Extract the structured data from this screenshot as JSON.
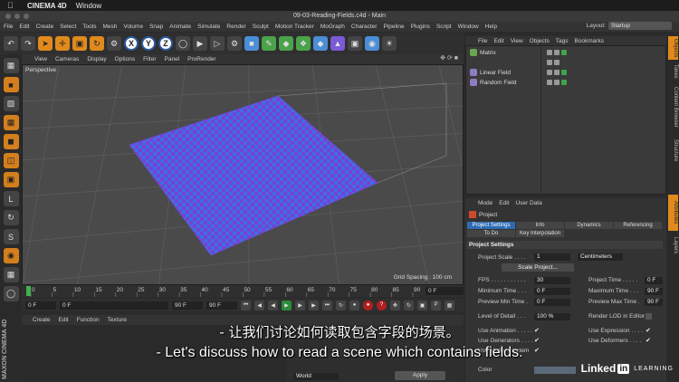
{
  "mac_menubar": {
    "app": "CINEMA 4D",
    "window": "Window"
  },
  "window_title": "09-03-Reading-Fields.c4d - Main",
  "menu": [
    "File",
    "Edit",
    "Create",
    "Select",
    "Tools",
    "Mesh",
    "Volume",
    "Snap",
    "Animate",
    "Simulate",
    "Render",
    "Sculpt",
    "Motion Tracker",
    "MoGraph",
    "Character",
    "Pipeline",
    "Plugins",
    "Script",
    "Window",
    "Help"
  ],
  "layout": {
    "label": "Layout:",
    "value": "Startup"
  },
  "toolbar": {
    "axis_x": "X",
    "axis_y": "Y",
    "axis_z": "Z"
  },
  "viewport": {
    "menu": [
      "View",
      "Cameras",
      "Display",
      "Options",
      "Filter",
      "Panel",
      "ProRender"
    ],
    "label": "Perspective",
    "grid_spacing": "Grid Spacing : 100 cm"
  },
  "timeline": {
    "ticks": [
      "0",
      "5",
      "10",
      "15",
      "20",
      "25",
      "30",
      "35",
      "40",
      "45",
      "50",
      "55",
      "60",
      "65",
      "70",
      "75",
      "80",
      "85",
      "90"
    ],
    "current_frame": "0 F"
  },
  "playbar": {
    "start": "0 F",
    "min": "0 F",
    "max": "90 F",
    "end": "90 F"
  },
  "material_menu": [
    "Create",
    "Edit",
    "Function",
    "Texture"
  ],
  "coords": {
    "apply": "Apply",
    "world": "World"
  },
  "maxon_logo": "MAXON CINEMA 4D",
  "object_manager": {
    "menu": [
      "File",
      "Edit",
      "View",
      "Objects",
      "Tags",
      "Bookmarks"
    ],
    "items": [
      {
        "name": "Matrix",
        "icon": "matrix-icon"
      },
      {
        "name": "Linear Field",
        "icon": "linear-field-icon"
      },
      {
        "name": "Random Field",
        "icon": "random-field-icon"
      }
    ]
  },
  "right_tabs": [
    "Objects",
    "Takes",
    "Content Browser",
    "Structure",
    "Attributes",
    "Layers"
  ],
  "attributes": {
    "menu": [
      "Mode",
      "Edit",
      "User Data"
    ],
    "title": "Project",
    "tabs": [
      "Project Settings",
      "Info",
      "Dynamics",
      "Referencing",
      "To Do",
      "Key Interpolation"
    ],
    "section": "Project Settings",
    "project_scale_label": "Project Scale . . . .",
    "project_scale_value": "1",
    "project_scale_unit": "Centimeters",
    "scale_project_button": "Scale Project...",
    "left_fields": [
      {
        "label": "FPS . . . . . . . . . . .",
        "value": "30"
      },
      {
        "label": "Minimum Time . . .",
        "value": "0 F"
      },
      {
        "label": "Preview Min Time .",
        "value": "0 F"
      },
      {
        "label": "Level of Detail . . .",
        "value": "100 %"
      }
    ],
    "right_fields": [
      {
        "label": "Project Time . . . . .",
        "value": "0 F"
      },
      {
        "label": "Maximum Time . . .",
        "value": "90 F"
      },
      {
        "label": "Preview Max Time .",
        "value": "90 F"
      }
    ],
    "render_lod": "Render LOD in Editor",
    "checks": [
      {
        "label": "Use Animation . . . . .",
        "value": "✔"
      },
      {
        "label": "Use Generators . . . .",
        "value": "✔"
      },
      {
        "label": "Use Motion System",
        "value": "✔"
      },
      {
        "label": "Use Expression . . . .",
        "value": "✔"
      },
      {
        "label": "Use Deformers . . . .",
        "value": "✔"
      }
    ],
    "color_label": "Color"
  },
  "subtitles": {
    "zh": "- 让我们讨论如何读取包含字段的场景。",
    "en": "- Let's discuss how to read a scene which contains fields."
  },
  "watermark": {
    "brand": "Linked",
    "in": "in",
    "learning": "LEARNING"
  }
}
